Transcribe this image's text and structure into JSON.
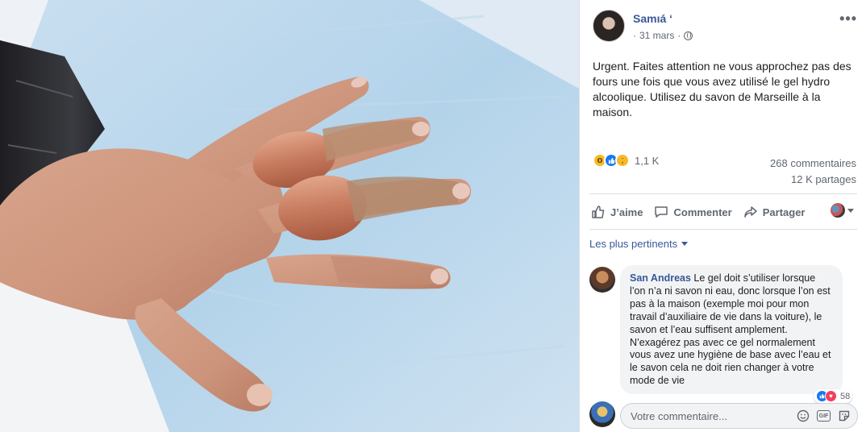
{
  "post": {
    "author": "Samıá ‘",
    "date": "31 mars",
    "date_separator": "·",
    "more_glyph": "•••",
    "text": "Urgent. Faites attention ne vous approchez pas des fours une fois que vous avez utilisé le gel hydro alcoolique. Utilisez du savon de Marseille à la maison.",
    "photo_icon": "burned-hand-photo"
  },
  "reactions": {
    "icons": [
      "wow-reaction-icon",
      "like-reaction-icon",
      "sad-reaction-icon"
    ],
    "count": "1,1 K",
    "comments": "268 commentaires",
    "shares": "12 K partages"
  },
  "actions": {
    "like": "J’aime",
    "comment": "Commenter",
    "share": "Partager"
  },
  "sort": {
    "label": "Les plus pertinents"
  },
  "comment": {
    "author": "San Andreas",
    "text": " Le gel doit s’utiliser lorsque l’on n’a ni savon ni eau, donc lorsque l’on est pas à la maison (exemple moi pour mon travail d’auxiliaire de vie dans la voiture), le savon et l’eau suffisent amplement. N’exagérez pas avec ce gel normalement vous avez une hygiène de base avec l’eau et le savon cela ne doit rien changer à votre mode de vie",
    "reaction_count": "58"
  },
  "reply": {
    "placeholder": "Votre commentaire...",
    "icons": [
      "emoji-icon",
      "gif-icon",
      "sticker-icon"
    ],
    "gif_label": "GIF"
  },
  "colors": {
    "link": "#385898",
    "secondary_text": "#606770",
    "like_blue": "#1877f2",
    "bubble_bg": "#f2f3f5"
  }
}
